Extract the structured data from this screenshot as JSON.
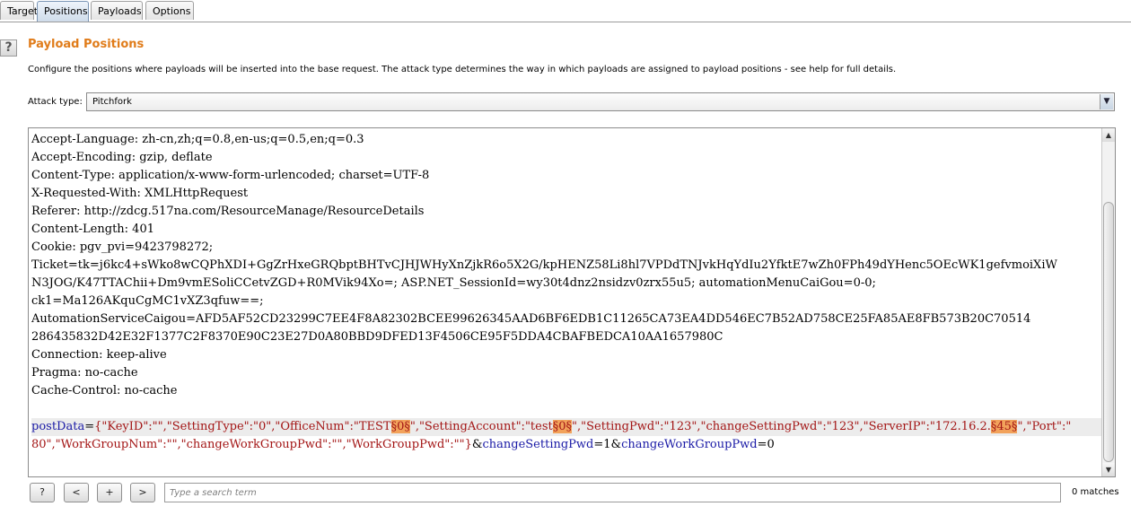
{
  "tabs": [
    {
      "label": "Target"
    },
    {
      "label": "Positions"
    },
    {
      "label": "Payloads"
    },
    {
      "label": "Options"
    }
  ],
  "help_label": "?",
  "heading": "Payload Positions",
  "description": "Configure the positions where payloads will be inserted into the base request. The attack type determines the way in which payloads are assigned to payload positions - see help for full details.",
  "attack": {
    "label": "Attack type:",
    "selected": "Pitchfork",
    "arrow": "▼"
  },
  "request": {
    "lines": [
      "Accept-Language: zh-cn,zh;q=0.8,en-us;q=0.5,en;q=0.3",
      "Accept-Encoding: gzip, deflate",
      "Content-Type: application/x-www-form-urlencoded; charset=UTF-8",
      "X-Requested-With: XMLHttpRequest",
      "Referer: http://zdcg.517na.com/ResourceManage/ResourceDetails",
      "Content-Length: 401",
      "Cookie: pgv_pvi=9423798272;",
      "Ticket=tk=j6kc4+sWko8wCQPhXDI+GgZrHxeGRQbptBHTvCJHJWHyXnZjkR6o5X2G/kpHENZ58Li8hl7VPDdTNJvkHqYdIu2YfktE7wZh0FPh49dYHenc5OEcWK1gefvmoiXiW",
      "N3JOG/K47TTAChii+Dm9vmESoliCCetvZGD+R0MVik94Xo=; ASP.NET_SessionId=wy30t4dnz2nsidzv0zrx55u5; automationMenuCaiGou=0-0;",
      "ck1=Ma126AKquCgMC1vXZ3qfuw==;",
      "AutomationServiceCaigou=AFD5AF52CD23299C7EE4F8A82302BCEE99626345AAD6BF6EDB1C11265CA73EA4DD546EC7B52AD758CE25FA85AE8FB573B20C70514",
      "286435832D42E32F1377C2F8370E90C23E27D0A80BBD9DFED13F4506CE95F5DDA4CBAFBEDCA10AA1657980C",
      "Connection: keep-alive",
      "Pragma: no-cache",
      "Cache-Control: no-cache",
      ""
    ],
    "body_line1": [
      {
        "t": "postData",
        "c": "name"
      },
      {
        "t": "=",
        "c": "plain"
      },
      {
        "t": "{\"KeyID\":\"\",\"SettingType\":\"0\",\"OfficeNum\":\"TEST",
        "c": "val"
      },
      {
        "t": "§0§",
        "c": "marker"
      },
      {
        "t": "\",\"SettingAccount\":\"test",
        "c": "val"
      },
      {
        "t": "§0§",
        "c": "marker"
      },
      {
        "t": "\",\"SettingPwd\":\"123\",\"changeSettingPwd\":\"123\",\"ServerIP\":\"172.16.2.",
        "c": "val"
      },
      {
        "t": "§45§",
        "c": "marker"
      },
      {
        "t": "\",\"Port\":\"",
        "c": "val"
      }
    ],
    "body_line2": [
      {
        "t": "80\",\"WorkGroupNum\":\"\",\"changeWorkGroupPwd\":\"\",\"WorkGroupPwd\":\"\"}",
        "c": "val"
      },
      {
        "t": "&",
        "c": "plain"
      },
      {
        "t": "changeSettingPwd",
        "c": "name"
      },
      {
        "t": "=1&",
        "c": "plain"
      },
      {
        "t": "changeWorkGroupPwd",
        "c": "name"
      },
      {
        "t": "=0",
        "c": "plain"
      }
    ]
  },
  "search": {
    "buttons": [
      "?",
      "<",
      "+",
      ">"
    ],
    "placeholder": "Type a search term",
    "matches": "0 matches"
  }
}
